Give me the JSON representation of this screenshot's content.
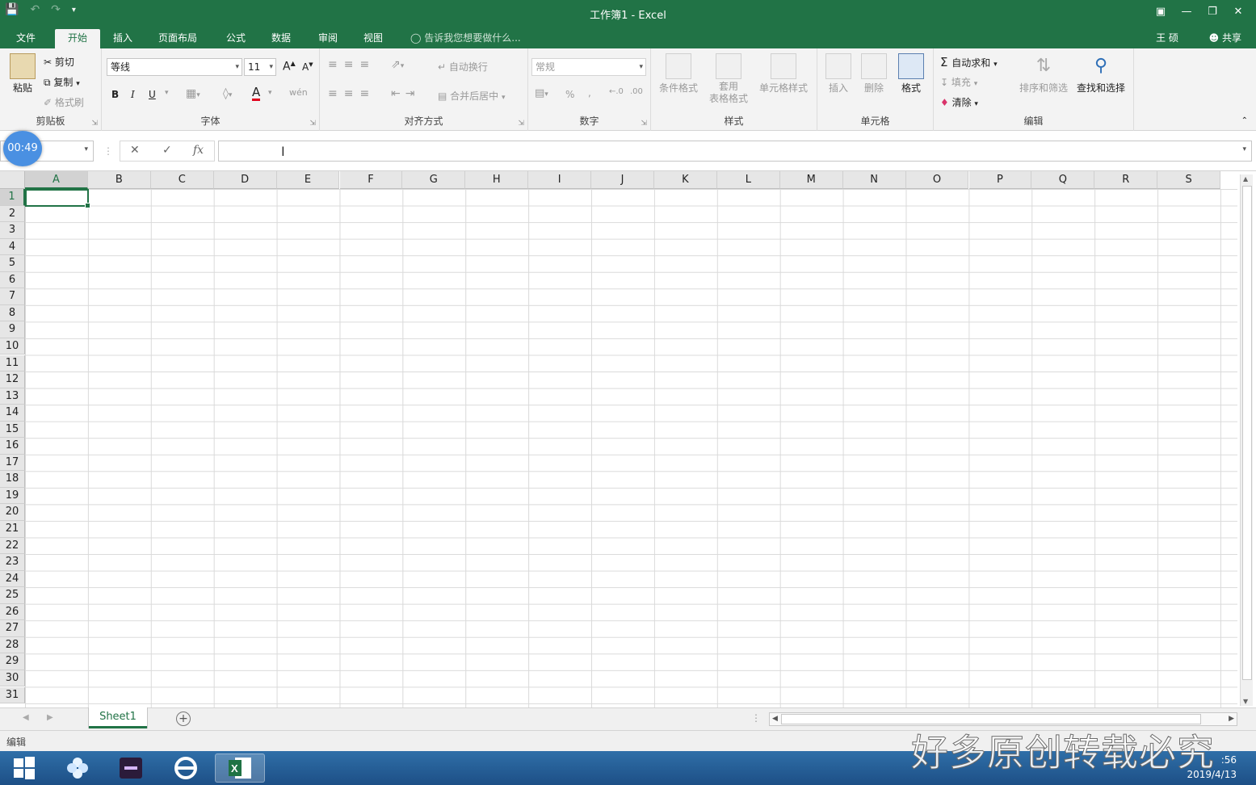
{
  "window": {
    "title": "工作簿1 - Excel"
  },
  "tabs": [
    {
      "label": "文件"
    },
    {
      "label": "开始"
    },
    {
      "label": "插入"
    },
    {
      "label": "页面布局"
    },
    {
      "label": "公式"
    },
    {
      "label": "数据"
    },
    {
      "label": "审阅"
    },
    {
      "label": "视图"
    }
  ],
  "tell_me": "告诉我您想要做什么...",
  "user": "王 硕",
  "share": "共享",
  "ribbon": {
    "clipboard": {
      "paste": "粘贴",
      "cut": "剪切",
      "copy": "复制",
      "format_painter": "格式刷",
      "label": "剪贴板"
    },
    "font": {
      "name": "等线",
      "size": "11",
      "grow": "A",
      "shrink": "A",
      "bold": "B",
      "italic": "I",
      "underline": "U",
      "font_color": "A",
      "phonetic": "wén",
      "label": "字体"
    },
    "alignment": {
      "wrap": "自动换行",
      "merge": "合并后居中",
      "label": "对齐方式"
    },
    "number": {
      "format": "常规",
      "percent": "%",
      "comma": ",",
      "label": "数字"
    },
    "styles": {
      "conditional": "条件格式",
      "table_l1": "套用",
      "table_l2": "表格格式",
      "cell_styles": "单元格样式",
      "label": "样式"
    },
    "cells": {
      "insert": "插入",
      "delete": "删除",
      "format": "格式",
      "label": "单元格"
    },
    "editing": {
      "autosum": "自动求和",
      "fill": "填充",
      "clear": "清除",
      "sort": "排序和筛选",
      "find": "查找和选择",
      "label": "编辑"
    }
  },
  "formula_bar": {
    "name_box": "",
    "fx": "fx",
    "cancel": "✕",
    "enter": "✓",
    "formula": ""
  },
  "timer": "00:49",
  "columns": [
    "A",
    "B",
    "C",
    "D",
    "E",
    "F",
    "G",
    "H",
    "I",
    "J",
    "K",
    "L",
    "M",
    "N",
    "O",
    "P",
    "Q",
    "R",
    "S"
  ],
  "rows": [
    "1",
    "2",
    "3",
    "4",
    "5",
    "6",
    "7",
    "8",
    "9",
    "10",
    "11",
    "12",
    "13",
    "14",
    "15",
    "16",
    "17",
    "18",
    "19",
    "20",
    "21",
    "22",
    "23",
    "24",
    "25",
    "26",
    "27",
    "28",
    "29",
    "30",
    "31"
  ],
  "sheets": [
    {
      "label": "Sheet1"
    }
  ],
  "status": "编辑",
  "clock": {
    "time": ":56",
    "date": "2019/4/13"
  },
  "watermark": "好多原创转载必究",
  "colors": {
    "accent": "#217346",
    "taskbar": "#1d4f86",
    "timer": "#4a90e2"
  }
}
